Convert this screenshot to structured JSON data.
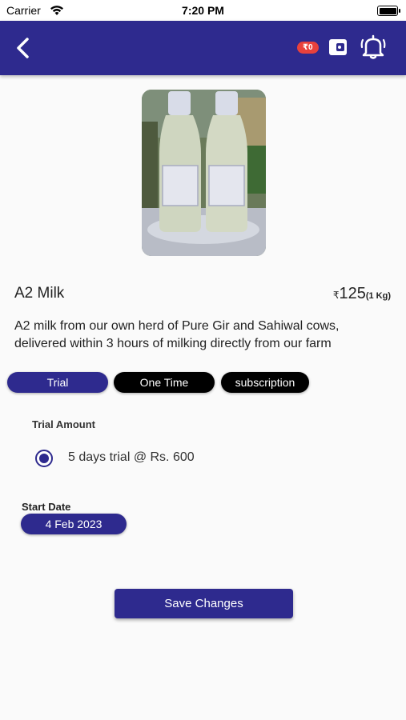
{
  "status_bar": {
    "carrier": "Carrier",
    "time": "7:20 PM"
  },
  "header": {
    "back_icon": "chevron-left-icon",
    "wallet_balance": "₹0",
    "wallet_icon": "wallet-icon",
    "bell_icon": "bell-icon",
    "background_color": "#2e2a8e"
  },
  "product": {
    "image": "milk-bottles-photo",
    "name": "A2 Milk",
    "currency": "₹",
    "price": "125",
    "unit": "(1 Kg)",
    "description": "A2 milk from our own herd of Pure Gir and Sahiwal cows, delivered within 3 hours of milking directly from our farm"
  },
  "tabs": [
    {
      "label": "Trial",
      "selected": true
    },
    {
      "label": "One Time",
      "selected": false
    },
    {
      "label": "subscription",
      "selected": false
    }
  ],
  "trial": {
    "section_label": "Trial Amount",
    "option_label": "5 days trial @ Rs. 600",
    "option_selected": true
  },
  "start_date": {
    "label": "Start Date",
    "value": "4 Feb 2023"
  },
  "save_button": {
    "label": "Save Changes"
  }
}
